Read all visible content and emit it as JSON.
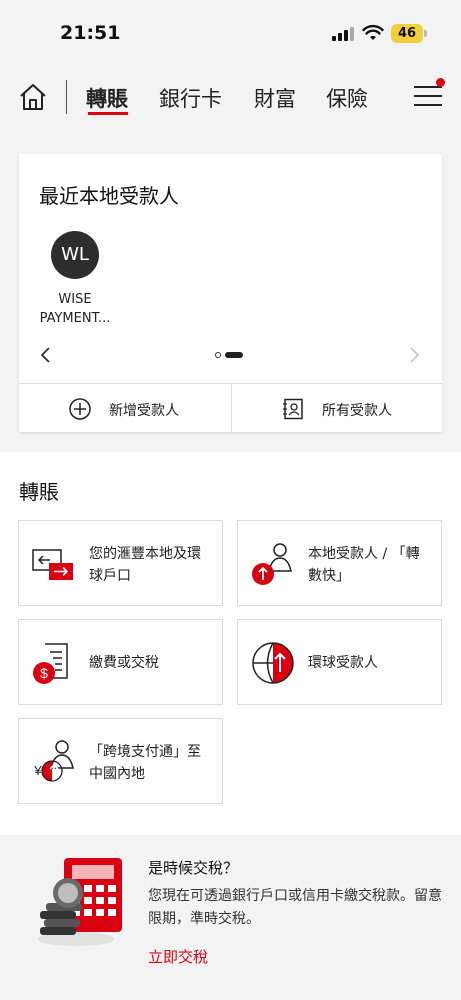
{
  "status_bar": {
    "time": "21:51",
    "battery": "46"
  },
  "nav": {
    "tabs": [
      "轉賬",
      "銀行卡",
      "財富",
      "保險"
    ],
    "active_tab": "轉賬"
  },
  "recent_payees": {
    "title": "最近本地受款人",
    "payee": {
      "initials": "WL",
      "name": "WISE PAYMENT..."
    },
    "add_label": "新增受款人",
    "all_label": "所有受款人"
  },
  "transfer": {
    "title": "轉賬",
    "tiles": [
      {
        "label": "您的滙豐本地及環球戶口",
        "icon": "own-account-transfer-icon"
      },
      {
        "label": "本地受款人 / 「轉數快」",
        "icon": "local-payee-icon"
      },
      {
        "label": "繳費或交稅",
        "icon": "bill-payment-icon"
      },
      {
        "label": "環球受款人",
        "icon": "global-payee-icon"
      },
      {
        "label": "「跨境支付通」至中國內地",
        "icon": "cross-boundary-payment-icon"
      }
    ]
  },
  "promo": {
    "title": "是時候交稅？",
    "text": "您現在可透過銀行戶口或信用卡繳交稅款。留意限期，準時交稅。",
    "link": "立即交稅"
  },
  "colors": {
    "accent": "#db0011",
    "background": "#f3f3f3"
  }
}
